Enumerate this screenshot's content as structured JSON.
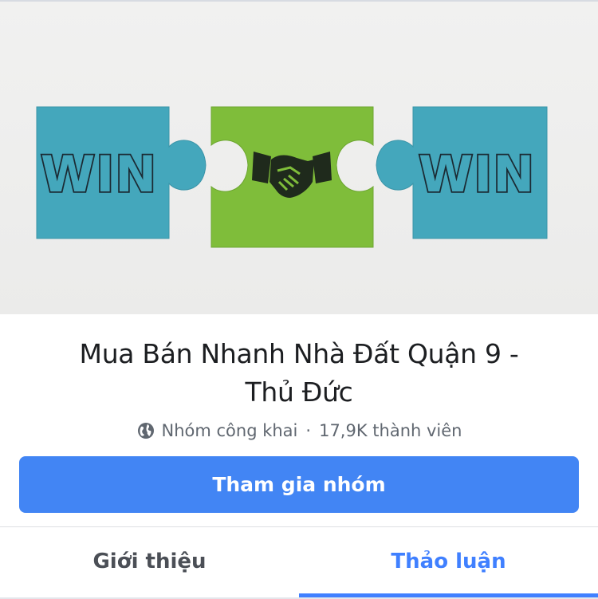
{
  "cover": {
    "left_piece_text": "WIN",
    "right_piece_text": "WIN",
    "center_icon": "handshake-icon"
  },
  "group": {
    "title_line1": "Mua Bán Nhanh Nhà Đất Quận 9 -",
    "title_line2": "Thủ Đức",
    "privacy_icon": "globe-icon",
    "privacy": "Nhóm công khai",
    "separator": "·",
    "members": "17,9K thành viên"
  },
  "actions": {
    "join_label": "Tham gia nhóm"
  },
  "tabs": [
    {
      "label": "Giới thiệu",
      "active": false
    },
    {
      "label": "Thảo luận",
      "active": true
    }
  ],
  "colors": {
    "accent": "#4080ff",
    "join_button": "#4285f4",
    "puzzle_blue": "#44a7bc",
    "puzzle_green": "#7fbd3a",
    "text_primary": "#1c1e21",
    "text_secondary": "#606770"
  }
}
